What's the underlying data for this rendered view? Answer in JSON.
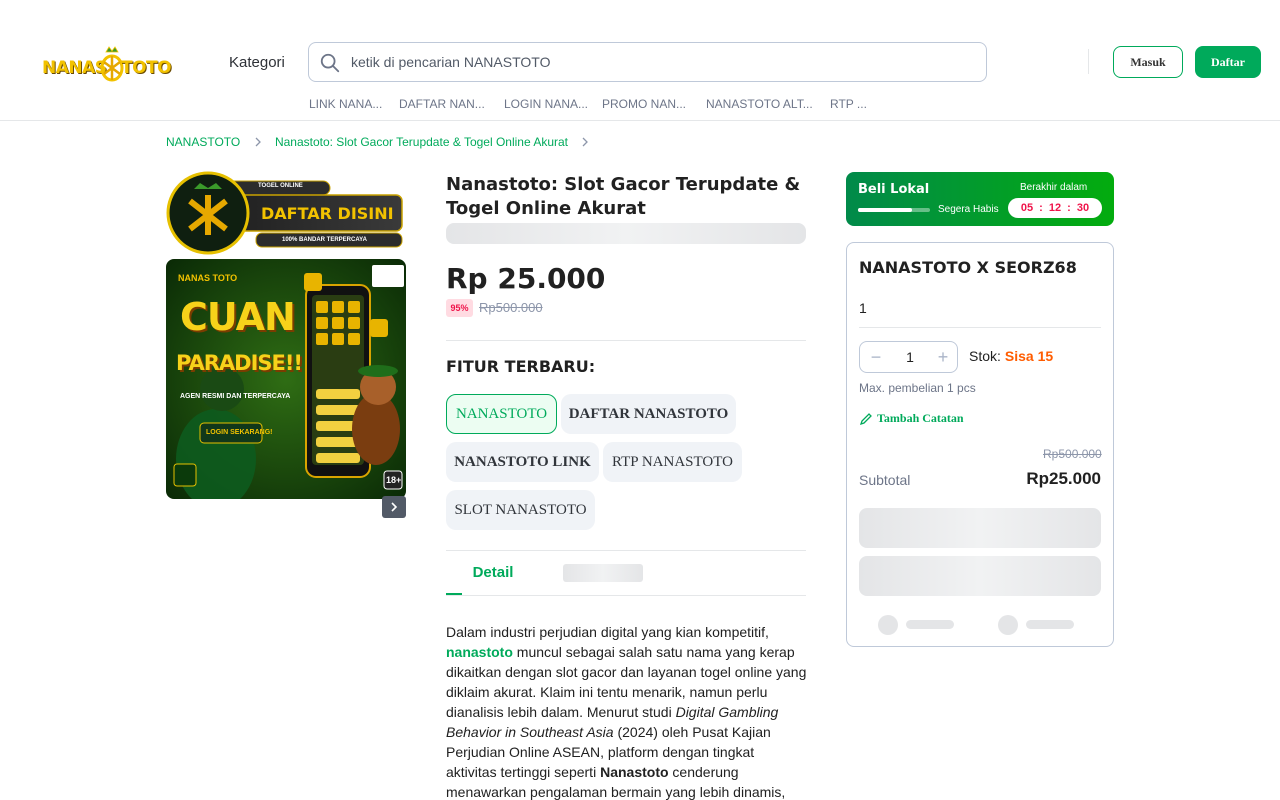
{
  "header": {
    "logo_left": "NANAS",
    "logo_right": "TOTO",
    "kategori": "Kategori",
    "search_placeholder": "ketik di pencarian NANASTOTO",
    "masuk": "Masuk",
    "daftar": "Daftar",
    "quicklinks": [
      "LINK NANA...",
      "DAFTAR NAN...",
      "LOGIN NANA...",
      "PROMO NAN...",
      "NANASTOTO ALT...",
      "RTP ..."
    ]
  },
  "breadcrumb": [
    "NANASTOTO",
    "Nanastoto: Slot Gacor Terupdate & Togel Online Akurat"
  ],
  "banner_top": {
    "badge": "TOGEL ONLINE",
    "cta": "DAFTAR DISINI",
    "sub": "100% BANDAR TERPERCAYA"
  },
  "banner_main": {
    "brand": "NANAS TOTO",
    "headline_1": "CUAN",
    "headline_2": "PARADISE!!",
    "tagline": "AGEN RESMI DAN TERPERCAYA",
    "login": "LOGIN SEKARANG!",
    "age": "18+"
  },
  "product": {
    "title": "Nanastoto: Slot Gacor Terupdate & Togel Online Akurat",
    "price": "Rp 25.000",
    "discount": "95%",
    "old_price": "Rp500.000",
    "fitur_label": "FITUR TERBARU:",
    "chips": [
      "NANASTOTO",
      "DAFTAR NANASTOTO",
      "NANASTOTO LINK",
      "RTP NANASTOTO",
      "SLOT NANASTOTO"
    ],
    "tab_detail": "Detail"
  },
  "description": {
    "p1_a": "Dalam industri perjudian digital yang kian kompetitif, ",
    "p1_link": "nanastoto",
    "p1_b": " muncul sebagai salah satu nama yang kerap dikaitkan dengan slot gacor dan layanan togel online yang diklaim akurat. Klaim ini tentu menarik, namun perlu dianalisis lebih dalam. Menurut studi ",
    "p1_em": "Digital Gambling Behavior in Southeast Asia",
    "p1_c": " (2024) oleh Pusat Kajian Perjudian Online ASEAN, platform dengan tingkat aktivitas tertinggi seperti ",
    "p1_bold": "Nanastoto",
    "p1_d": " cenderung menawarkan pengalaman bermain yang lebih dinamis,"
  },
  "flash_sale": {
    "title": "Beli Lokal",
    "habis": "Segera Habis",
    "berakhir": "Berakhir dalam",
    "hh": "05",
    "mm": "12",
    "ss": "30",
    "progress": 0.75
  },
  "cart": {
    "title": "NANASTOTO X SEORZ68",
    "variant": "1",
    "qty": "1",
    "stok_label": "Stok:",
    "stok_value": "Sisa 15",
    "max": "Max. pembelian 1 pcs",
    "catatan": "Tambah Catatan",
    "old_price": "Rp500.000",
    "subtotal_label": "Subtotal",
    "subtotal_value": "Rp25.000"
  },
  "colors": {
    "brand_green": "#00aa5b",
    "discount_red": "#ef144a",
    "stock_orange": "#ff5c00"
  }
}
